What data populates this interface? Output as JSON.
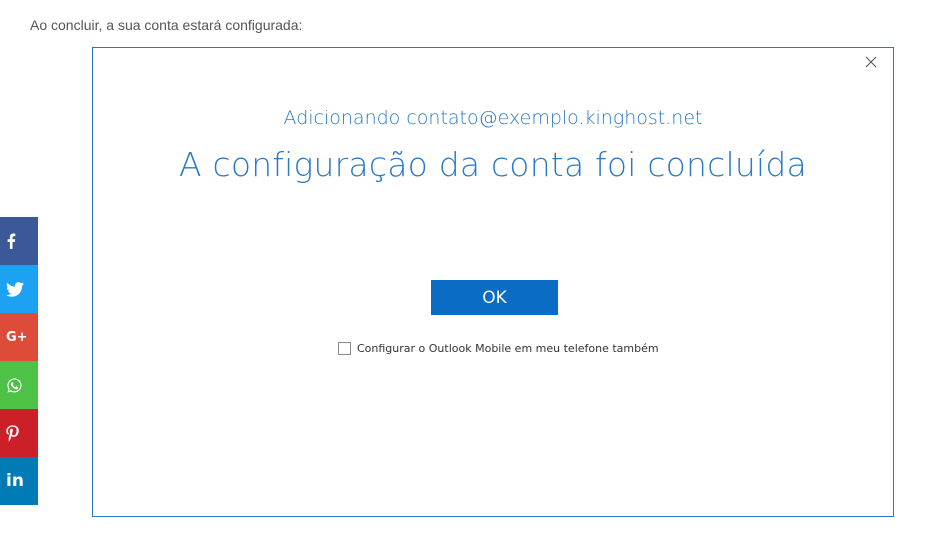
{
  "article": {
    "intro_text": "Ao concluir, a sua conta estará configurada:"
  },
  "dialog": {
    "subtitle": "Adicionando contato@exemplo.kinghost.net",
    "title": "A configuração da conta foi concluída",
    "ok_label": "OK",
    "checkbox_label": "Configurar o Outlook Mobile em meu telefone também",
    "checkbox_checked": false,
    "close_icon": "close-icon",
    "accent_color": "#2b7ac4",
    "button_color": "#0a6cc4"
  },
  "social_bar": {
    "items": [
      {
        "name": "facebook",
        "icon": "facebook-icon",
        "color": "#3b5998"
      },
      {
        "name": "twitter",
        "icon": "twitter-icon",
        "color": "#1da1f2"
      },
      {
        "name": "google-plus",
        "icon": "google-plus-icon",
        "color": "#dd4b39",
        "glyph": "G+"
      },
      {
        "name": "whatsapp",
        "icon": "whatsapp-icon",
        "color": "#4dc247"
      },
      {
        "name": "pinterest",
        "icon": "pinterest-icon",
        "color": "#cb2027"
      },
      {
        "name": "linkedin",
        "icon": "linkedin-icon",
        "color": "#007bb5",
        "glyph": "in"
      }
    ]
  }
}
